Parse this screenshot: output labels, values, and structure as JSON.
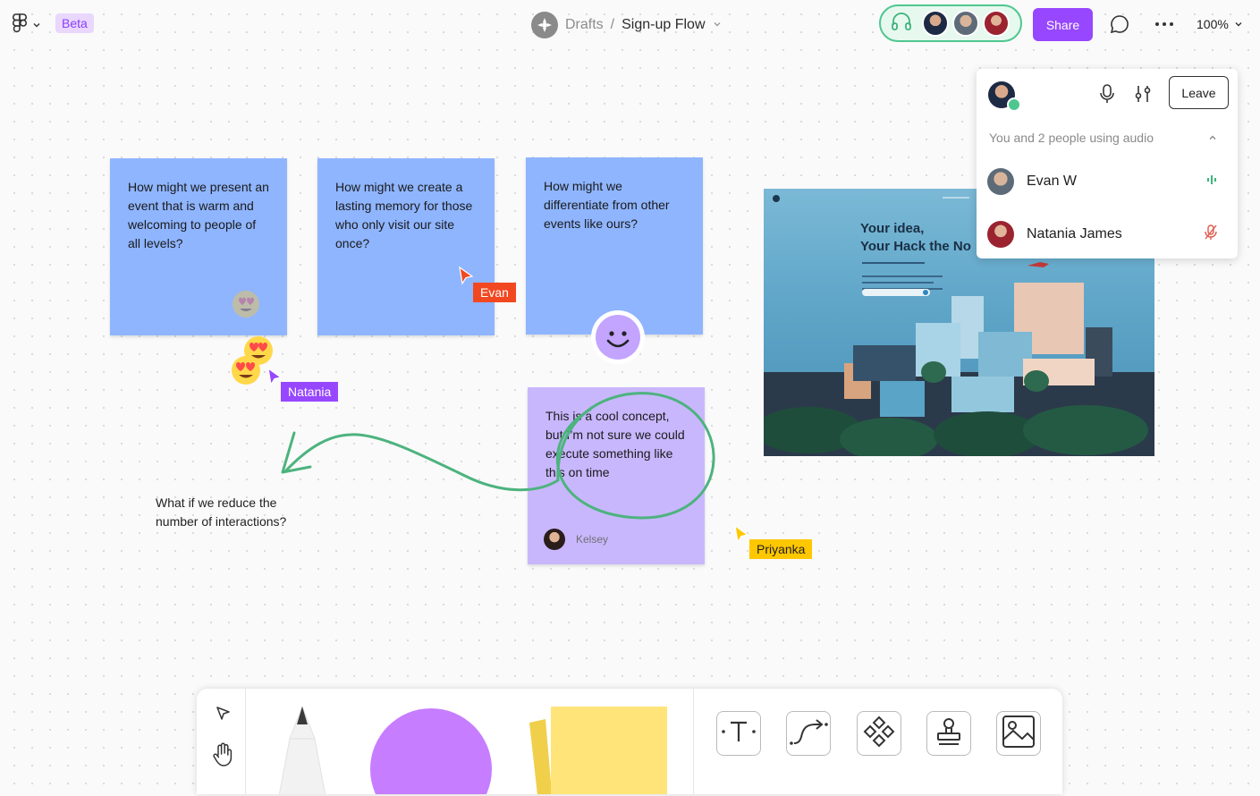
{
  "header": {
    "beta_label": "Beta",
    "breadcrumb_parent": "Drafts",
    "breadcrumb_separator": "/",
    "file_name": "Sign-up Flow",
    "share_label": "Share",
    "zoom_label": "100%"
  },
  "audio_panel": {
    "leave_label": "Leave",
    "summary": "You and 2 people using audio",
    "participants": [
      {
        "name": "Evan W",
        "status": "speaking"
      },
      {
        "name": "Natania James",
        "status": "muted"
      }
    ]
  },
  "canvas": {
    "stickies": [
      {
        "text": "How might we present an event that is warm and welcoming to people of all levels?"
      },
      {
        "text": "How might we create a lasting memory for those who only visit our site once?"
      },
      {
        "text": "How might we differentiate from other events like ours?"
      }
    ],
    "comment_sticky": {
      "text": "This is a cool concept, but I’m not sure we could execute something like this on time",
      "author": "Kelsey"
    },
    "free_text": "What if we reduce the number of interactions?",
    "cursors": [
      {
        "name": "Evan",
        "color": "#f24822"
      },
      {
        "name": "Natania",
        "color": "#9747ff"
      },
      {
        "name": "Priyanka",
        "color": "#ffc700"
      }
    ],
    "image_card": {
      "headline_line1": "Your idea,",
      "headline_line2": "Your Hack the No"
    }
  },
  "colors": {
    "accent": "#9747ff",
    "sticky_blue": "#8fb5ff",
    "sticky_purple": "#c9b7fe",
    "audio_green": "#4ec78f",
    "stroke_green": "#4db37e"
  },
  "icons": [
    "figma-menu-icon",
    "chevron-down-icon",
    "headphones-icon",
    "comment-icon",
    "more-icon",
    "microphone-icon",
    "sliders-icon",
    "chevron-up-icon",
    "audio-wave-icon",
    "mic-off-icon",
    "move-cursor-icon",
    "hand-icon",
    "pencil-icon",
    "shape-icon",
    "sticky-note-icon",
    "text-icon",
    "connector-icon",
    "component-icon",
    "stamp-icon",
    "image-icon"
  ]
}
